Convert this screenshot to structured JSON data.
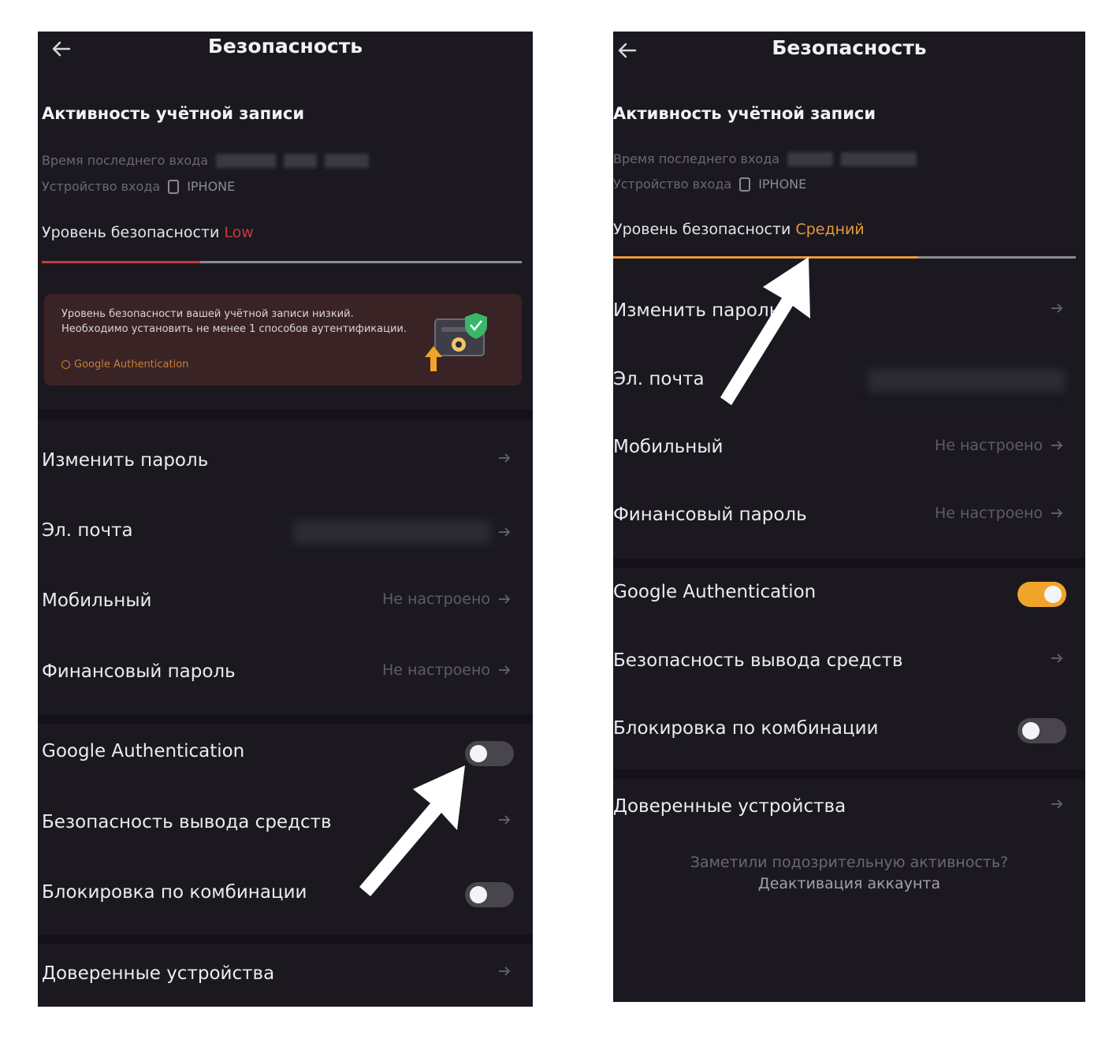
{
  "left": {
    "title": "Безопасность",
    "account_activity_heading": "Активность учётной записи",
    "last_login_label": "Время последнего входа",
    "login_device_label": "Устройство входа",
    "login_device_value": "IPHONE",
    "security_level_label": "Уровень безопасности",
    "security_level_value": "Low",
    "security_level_progress": 0.33,
    "alert": {
      "text": "Уровень безопасности вашей учётной записи низкий. Необходимо установить не менее 1 способов аутентификации.",
      "link": "Google Authentication"
    },
    "rows": {
      "change_password": "Изменить пароль",
      "email": "Эл. почта",
      "mobile": "Мобильный",
      "mobile_status": "Не настроено",
      "financial_password": "Финансовый пароль",
      "financial_status": "Не настроено",
      "google_auth": "Google Authentication",
      "google_auth_enabled": false,
      "withdrawal_security": "Безопасность вывода средств",
      "pattern_lock": "Блокировка по комбинации",
      "pattern_lock_enabled": false,
      "trusted_devices": "Доверенные устройства"
    }
  },
  "right": {
    "title": "Безопасность",
    "account_activity_heading": "Активность учётной записи",
    "last_login_label": "Время последнего входа",
    "login_device_label": "Устройство входа",
    "login_device_value": "IPHONE",
    "security_level_label": "Уровень безопасности",
    "security_level_value": "Средний",
    "security_level_progress": 0.66,
    "rows": {
      "change_password": "Изменить пароль",
      "email": "Эл. почта",
      "mobile": "Мобильный",
      "mobile_status": "Не настроено",
      "financial_password": "Финансовый пароль",
      "financial_status": "Не настроено",
      "google_auth": "Google Authentication",
      "google_auth_enabled": true,
      "withdrawal_security": "Безопасность вывода средств",
      "pattern_lock": "Блокировка по комбинации",
      "pattern_lock_enabled": false,
      "trusted_devices": "Доверенные устройства"
    },
    "footer": {
      "question": "Заметили подозрительную активность?",
      "link": "Деактивация аккаунта"
    }
  },
  "colors": {
    "background": "#1b1820",
    "low_level": "#c23a3f",
    "medium_level": "#e79b3a",
    "toggle_on": "#f0a52a"
  },
  "icons": [
    "back-arrow-icon",
    "phone-icon",
    "chevron-right-arrow-icon",
    "info-icon",
    "shield-check-icon",
    "annotation-arrow-icon"
  ]
}
